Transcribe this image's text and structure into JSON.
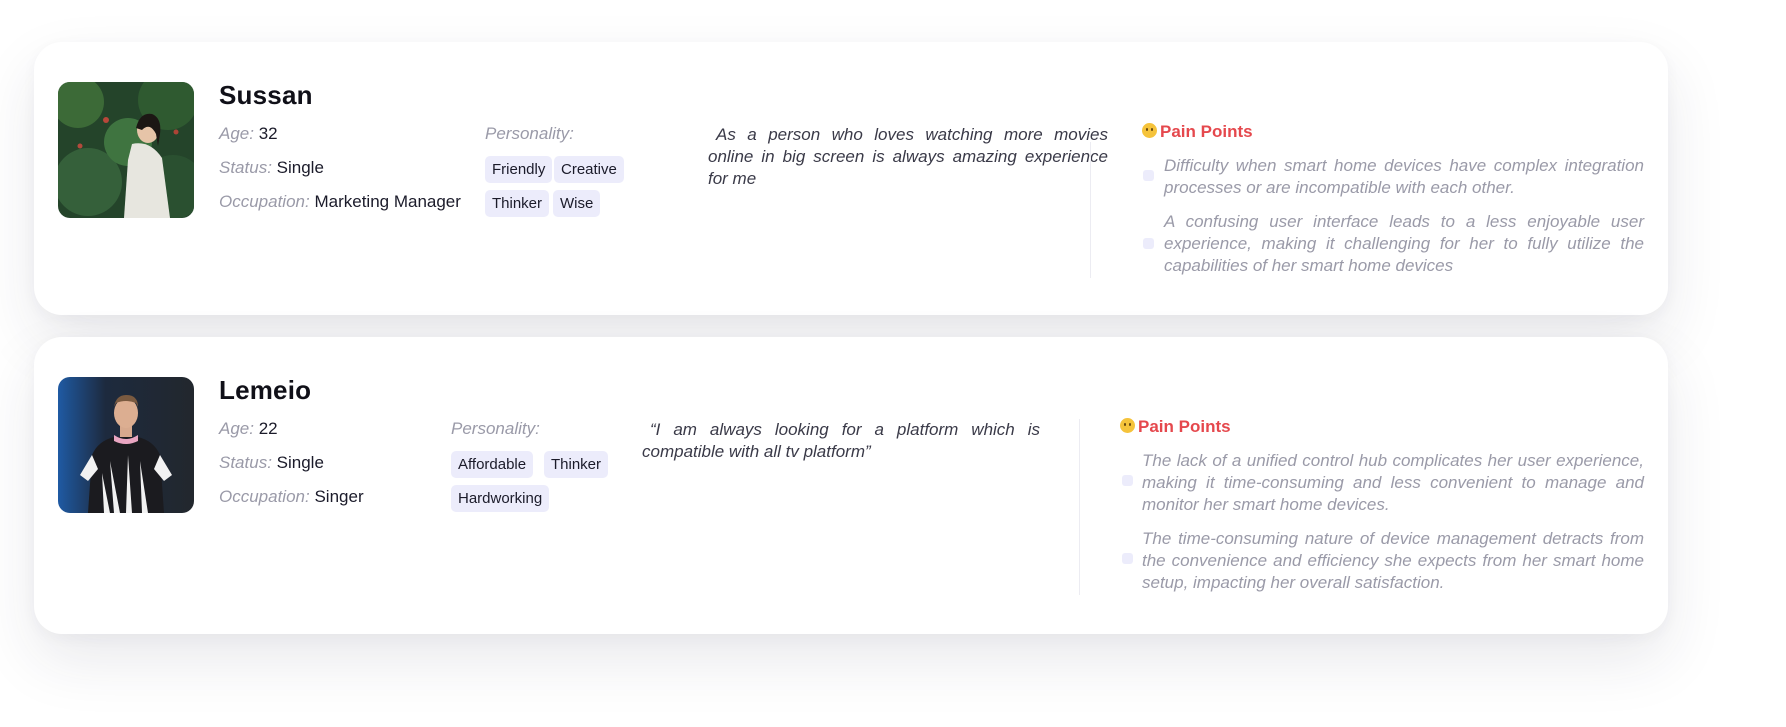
{
  "personas": [
    {
      "name": "Sussan",
      "age_label": "Age:",
      "age": "32",
      "status_label": "Status:",
      "status": "Single",
      "occupation_label": "Occupation:",
      "occupation": "Marketing Manager",
      "personality_label": "Personality:",
      "tags": [
        "Friendly",
        "Creative",
        "Thinker",
        "Wise"
      ],
      "quote": "As a person who loves watching more movies online in big screen is always amazing experience for me",
      "pain_points_title": "Pain Points",
      "pain_points": [
        "Difficulty when smart home devices have complex integration processes or are incompatible with each other.",
        "A confusing user interface leads to a less enjoyable user experience, making it challenging for her to fully utilize the capabilities of her smart home devices"
      ]
    },
    {
      "name": "Lemeio",
      "age_label": "Age:",
      "age": "22",
      "status_label": "Status:",
      "status": "Single",
      "occupation_label": "Occupation:",
      "occupation": "Singer",
      "personality_label": "Personality:",
      "tags": [
        "Affordable",
        "Thinker",
        "Hardworking"
      ],
      "quote": "“I am always looking for a platform which is compatible with all tv platform”",
      "pain_points_title": "Pain Points",
      "pain_points": [
        "The lack of a unified control hub complicates her user experience, making it time-consuming and less convenient to manage and monitor her smart home devices.",
        "The time-consuming nature of device management detracts from the convenience and efficiency she expects from her smart home setup, impacting her overall satisfaction."
      ]
    }
  ],
  "colors": {
    "accent_red": "#e5484d",
    "tag_bg": "#ececfb",
    "muted_text": "#9a9aa8"
  }
}
